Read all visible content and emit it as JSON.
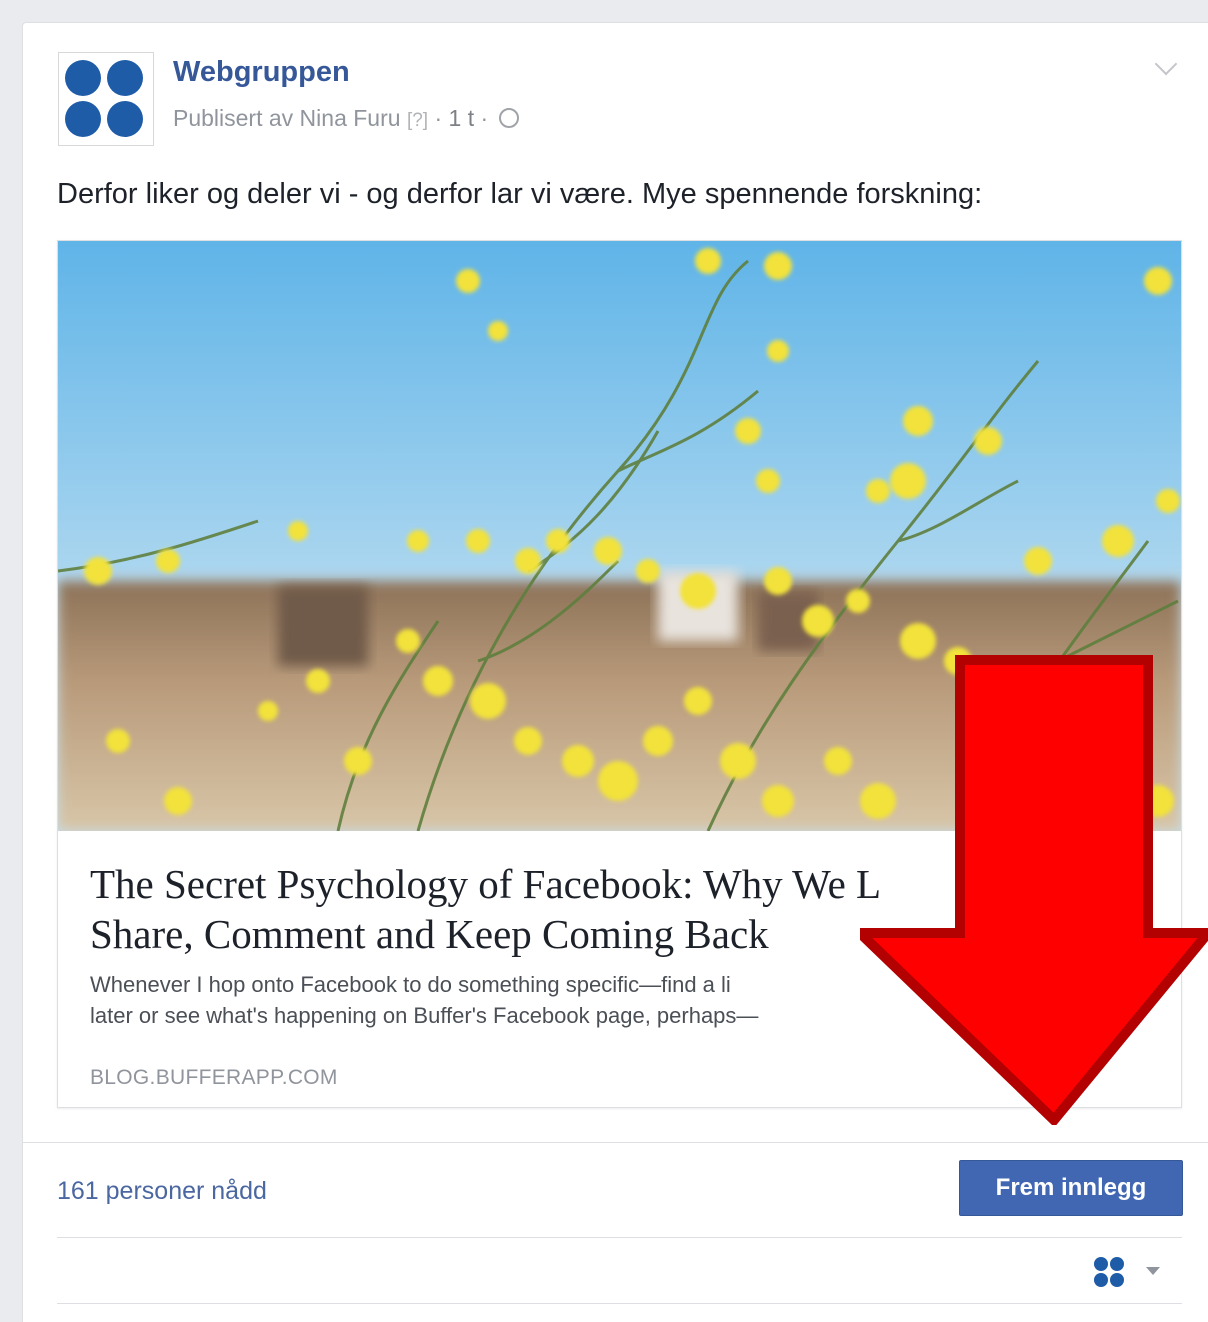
{
  "post": {
    "page_name": "Webgruppen",
    "published_by": "Publisert av Nina Furu",
    "help_marker": "[?]",
    "separator": "·",
    "age": "1 t",
    "privacy_icon": "globe-icon",
    "menu_icon": "chevron-down-icon",
    "text": "Derfor liker og deler vi - og derfor lar vi være. Mye spennende forskning:"
  },
  "link_preview": {
    "image_description_icon": "flower-photo",
    "title_line1": "The Secret Psychology of Facebook: Why We L",
    "title_line2": "Share, Comment and Keep Coming Back",
    "description_line1": "Whenever I hop onto Facebook to do something specific—find a li",
    "description_line2": "later or see what's happening on Buffer's Facebook page, perhaps—",
    "domain": "BLOG.BUFFERAPP.COM"
  },
  "footer": {
    "reach": "161 personer nådd",
    "boost_label": "Frem innlegg",
    "page_switch_icon": "page-avatar-icon",
    "dropdown_icon": "caret-down-icon"
  },
  "annotation": {
    "arrow_icon": "red-down-arrow",
    "arrow_color": "#ff0000",
    "arrow_outline": "#b30000"
  },
  "colors": {
    "brand_blue": "#365899",
    "button_blue": "#4267b2",
    "logo_blue": "#1f5ca8"
  }
}
